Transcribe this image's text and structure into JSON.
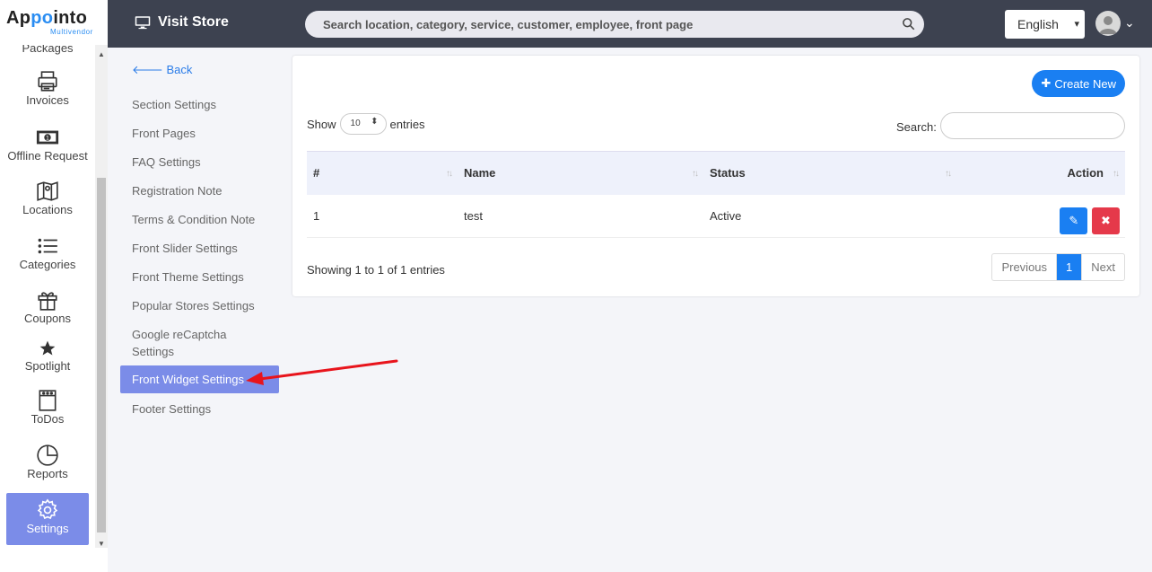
{
  "app": {
    "name_a": "Ap",
    "name_b": "po",
    "name_c": "into",
    "subtitle": "Multivendor"
  },
  "topbar": {
    "visit_store": "Visit Store",
    "search_placeholder": "Search location, category, service, customer, employee, front page",
    "language": "English"
  },
  "sidebar": {
    "partial_item": "Packages",
    "items": [
      {
        "label": "Invoices",
        "icon": "printer-icon"
      },
      {
        "label": "Offline Request",
        "icon": "money-icon"
      },
      {
        "label": "Locations",
        "icon": "map-icon"
      },
      {
        "label": "Categories",
        "icon": "list-icon"
      },
      {
        "label": "Coupons",
        "icon": "gift-icon"
      },
      {
        "label": "Spotlight",
        "icon": "star-icon"
      },
      {
        "label": "ToDos",
        "icon": "notepad-icon"
      },
      {
        "label": "Reports",
        "icon": "pie-chart-icon"
      },
      {
        "label": "Settings",
        "icon": "gear-icon",
        "active": true
      }
    ]
  },
  "submenu": {
    "back": "Back",
    "items": [
      "Section Settings",
      "Front Pages",
      "FAQ Settings",
      "Registration Note",
      "Terms & Condition Note",
      "Front Slider Settings",
      "Front Theme Settings",
      "Popular Stores Settings",
      "Google reCaptcha Settings",
      "Front Widget Settings",
      "Footer Settings"
    ],
    "active": "Front Widget Settings"
  },
  "card": {
    "create_new": "Create New",
    "show": "Show",
    "entries_value": "10",
    "entries": "entries",
    "search_label": "Search:",
    "columns": [
      "#",
      "Name",
      "Status",
      "Action"
    ],
    "rows": [
      {
        "num": "1",
        "name": "test",
        "status": "Active"
      }
    ],
    "showing": "Showing 1 to 1 of 1 entries",
    "pager": {
      "previous": "Previous",
      "current": "1",
      "next": "Next"
    }
  },
  "colors": {
    "accent": "#1a7ff2",
    "active_nav": "#7b8ce8",
    "topbar": "#3d4250",
    "danger": "#e5394a",
    "annotation": "#e8141c"
  }
}
